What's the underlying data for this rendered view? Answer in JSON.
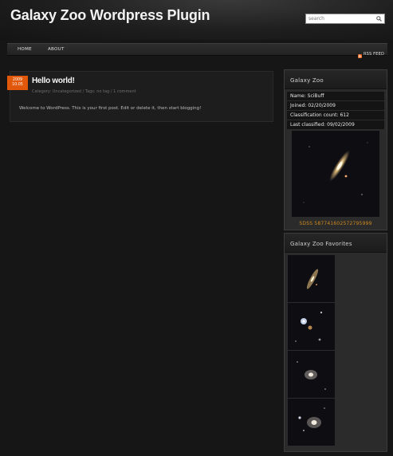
{
  "site": {
    "title": "Galaxy Zoo Wordpress Plugin"
  },
  "search": {
    "placeholder": "search"
  },
  "nav": {
    "items": [
      {
        "label": "HOME"
      },
      {
        "label": "ABOUT"
      }
    ],
    "rss_label": "RSS FEED"
  },
  "post": {
    "date_year": "2009",
    "date_day": "10.05",
    "title": "Hello world!",
    "meta_category_prefix": "Category: ",
    "meta_category": "Uncategorized",
    "meta_tags_prefix": " / Tags: ",
    "meta_tags": "no tag",
    "meta_sep": " / ",
    "meta_comments": "1 comment",
    "body": "Welcome to WordPress. This is your first post. Edit or delete it, then start blogging!"
  },
  "galaxy_zoo_widget": {
    "title": "Galaxy Zoo",
    "rows": [
      {
        "text": "Name: SciBuff"
      },
      {
        "text": "Joined: 02/20/2009"
      },
      {
        "text": "Classification count: 612"
      },
      {
        "text": "Last classified: 09/02/2009"
      }
    ],
    "object_id": "SDSS 587741602572795999"
  },
  "favorites_widget": {
    "title": "Galaxy Zoo Favorites"
  },
  "colors": {
    "accent": "#e2580b",
    "link": "#cf8a1e",
    "rss": "#e8641b"
  }
}
